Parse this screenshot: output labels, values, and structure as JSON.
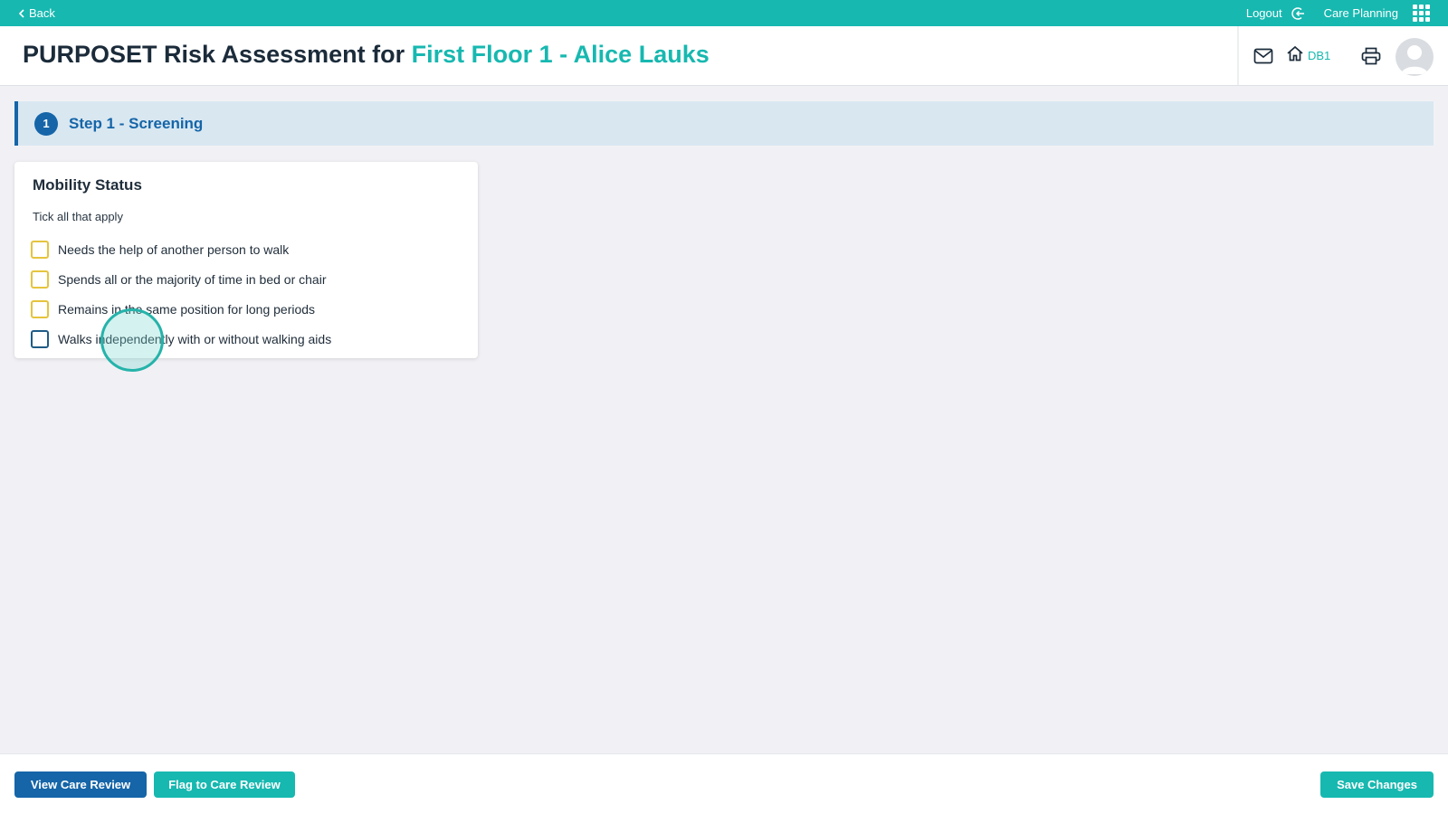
{
  "topbar": {
    "back_label": "Back",
    "logout_label": "Logout",
    "app_label": "Care Planning",
    "icons": {
      "back": "chevron-left-icon",
      "logout": "logout-icon",
      "apps": "grid-icon"
    }
  },
  "header": {
    "title_prefix": "PURPOSET Risk Assessment for",
    "title_subject": "First Floor 1 - Alice Lauks",
    "home_label": "DB1",
    "icons": {
      "mail": "mail-icon",
      "home": "home-icon",
      "print": "printer-icon",
      "avatar": "user-avatar-icon"
    }
  },
  "step": {
    "number": "1",
    "title": "Step 1 - Screening"
  },
  "card": {
    "title": "Mobility Status",
    "subtitle": "Tick all that apply",
    "options": [
      {
        "label": "Needs the help of another person to walk",
        "checked": false
      },
      {
        "label": "Spends all or the majority of time in bed or chair",
        "checked": false
      },
      {
        "label": "Remains in the same position for long periods",
        "checked": false
      },
      {
        "label": "Walks independently with or without walking aids",
        "checked": false
      }
    ]
  },
  "footer": {
    "view_care_review_label": "View Care Review",
    "flag_care_review_label": "Flag to Care Review",
    "save_label": "Save Changes"
  },
  "colors": {
    "teal": "#17b8b0",
    "navy": "#1565a8",
    "banner_bg": "#d9e7f1",
    "checkbox_yellow": "#e5c43d",
    "page_bg": "#f1f1f5"
  }
}
